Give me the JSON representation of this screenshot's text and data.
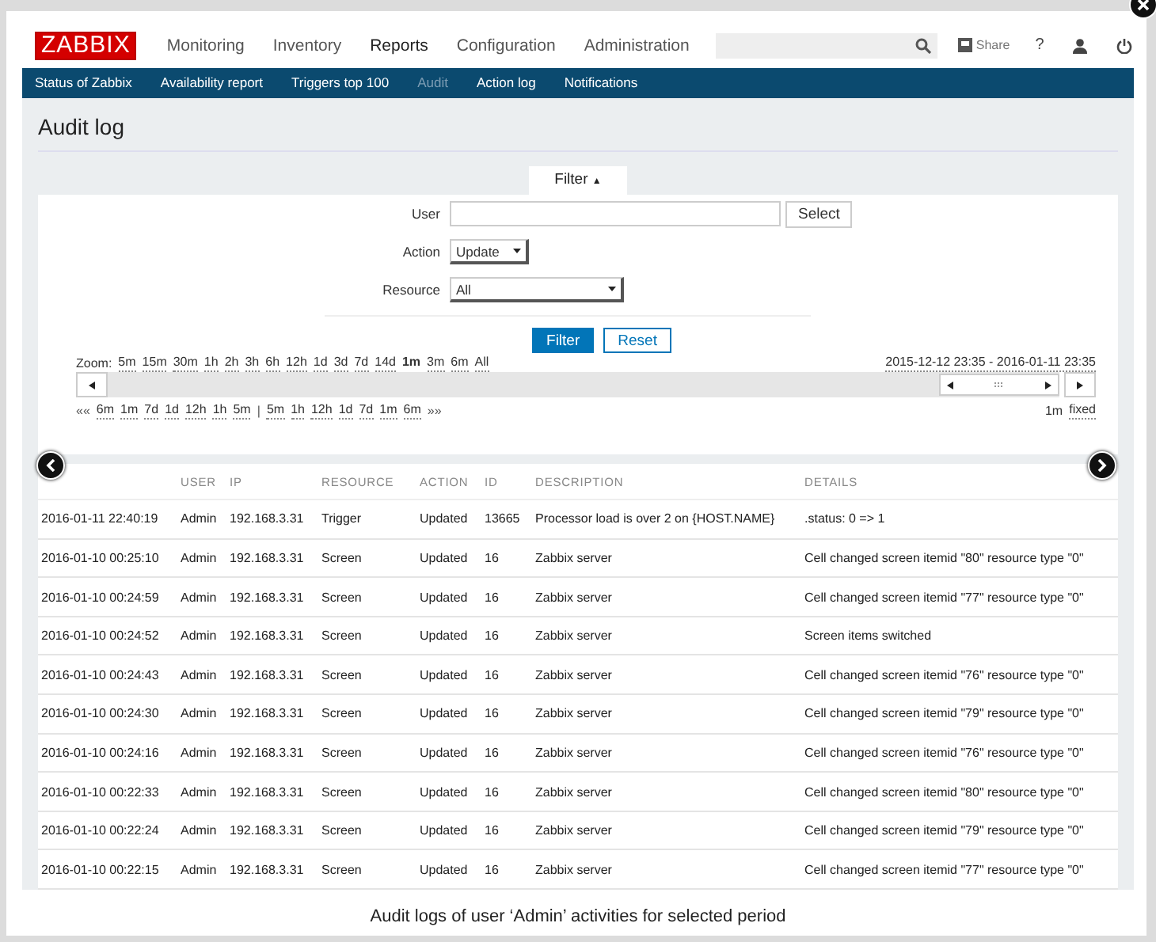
{
  "header": {
    "logo": "ZABBIX",
    "menu": [
      {
        "label": "Monitoring",
        "selected": false
      },
      {
        "label": "Inventory",
        "selected": false
      },
      {
        "label": "Reports",
        "selected": true
      },
      {
        "label": "Configuration",
        "selected": false
      },
      {
        "label": "Administration",
        "selected": false
      }
    ],
    "share": "Share",
    "help": "?"
  },
  "submenu": [
    {
      "label": "Status of Zabbix",
      "selected": false
    },
    {
      "label": "Availability report",
      "selected": false
    },
    {
      "label": "Triggers top 100",
      "selected": false
    },
    {
      "label": "Audit",
      "selected": true
    },
    {
      "label": "Action log",
      "selected": false
    },
    {
      "label": "Notifications",
      "selected": false
    }
  ],
  "page_title": "Audit log",
  "filter": {
    "tab": "Filter",
    "tab_arrow": "▲",
    "user_label": "User",
    "select_button": "Select",
    "action_label": "Action",
    "action_value": "Update",
    "resource_label": "Resource",
    "resource_value": "All",
    "apply_button": "Filter",
    "reset_button": "Reset"
  },
  "timeline": {
    "zoom_label": "Zoom:",
    "zoom": [
      {
        "label": "5m",
        "selected": false
      },
      {
        "label": "15m",
        "selected": false
      },
      {
        "label": "30m",
        "selected": false
      },
      {
        "label": "1h",
        "selected": false
      },
      {
        "label": "2h",
        "selected": false
      },
      {
        "label": "3h",
        "selected": false
      },
      {
        "label": "6h",
        "selected": false
      },
      {
        "label": "12h",
        "selected": false
      },
      {
        "label": "1d",
        "selected": false
      },
      {
        "label": "3d",
        "selected": false
      },
      {
        "label": "7d",
        "selected": false
      },
      {
        "label": "14d",
        "selected": false
      },
      {
        "label": "1m",
        "selected": true
      },
      {
        "label": "3m",
        "selected": false
      },
      {
        "label": "6m",
        "selected": false
      },
      {
        "label": "All",
        "selected": false
      }
    ],
    "period": "2015-12-12 23:35 - 2016-01-11 23:35",
    "nav": [
      {
        "label": "««",
        "kind": "sep"
      },
      {
        "label": "6m",
        "kind": "link"
      },
      {
        "label": "1m",
        "kind": "link"
      },
      {
        "label": "7d",
        "kind": "link"
      },
      {
        "label": "1d",
        "kind": "link"
      },
      {
        "label": "12h",
        "kind": "link"
      },
      {
        "label": "1h",
        "kind": "link"
      },
      {
        "label": "5m",
        "kind": "link"
      },
      {
        "label": "|",
        "kind": "sep"
      },
      {
        "label": "5m",
        "kind": "link"
      },
      {
        "label": "1h",
        "kind": "link"
      },
      {
        "label": "12h",
        "kind": "link"
      },
      {
        "label": "1d",
        "kind": "link"
      },
      {
        "label": "7d",
        "kind": "link"
      },
      {
        "label": "1m",
        "kind": "link"
      },
      {
        "label": "6m",
        "kind": "link"
      },
      {
        "label": "»»",
        "kind": "sep"
      }
    ],
    "period_length": "1m",
    "fixed": "fixed"
  },
  "table": {
    "columns": [
      "",
      "USER",
      "IP",
      "RESOURCE",
      "ACTION",
      "ID",
      "DESCRIPTION",
      "DETAILS"
    ],
    "rows": [
      [
        "2016-01-11 22:40:19",
        "Admin",
        "192.168.3.31",
        "Trigger",
        "Updated",
        "13665",
        "Processor load is over 2 on {HOST.NAME}",
        ".status: 0 => 1"
      ],
      [
        "2016-01-10 00:25:10",
        "Admin",
        "192.168.3.31",
        "Screen",
        "Updated",
        "16",
        "Zabbix server",
        "Cell changed screen itemid \"80\" resource type \"0\""
      ],
      [
        "2016-01-10 00:24:59",
        "Admin",
        "192.168.3.31",
        "Screen",
        "Updated",
        "16",
        "Zabbix server",
        "Cell changed screen itemid \"77\" resource type \"0\""
      ],
      [
        "2016-01-10 00:24:52",
        "Admin",
        "192.168.3.31",
        "Screen",
        "Updated",
        "16",
        "Zabbix server",
        "Screen items switched"
      ],
      [
        "2016-01-10 00:24:43",
        "Admin",
        "192.168.3.31",
        "Screen",
        "Updated",
        "16",
        "Zabbix server",
        "Cell changed screen itemid \"76\" resource type \"0\""
      ],
      [
        "2016-01-10 00:24:30",
        "Admin",
        "192.168.3.31",
        "Screen",
        "Updated",
        "16",
        "Zabbix server",
        "Cell changed screen itemid \"79\" resource type \"0\""
      ],
      [
        "2016-01-10 00:24:16",
        "Admin",
        "192.168.3.31",
        "Screen",
        "Updated",
        "16",
        "Zabbix server",
        "Cell changed screen itemid \"76\" resource type \"0\""
      ],
      [
        "2016-01-10 00:22:33",
        "Admin",
        "192.168.3.31",
        "Screen",
        "Updated",
        "16",
        "Zabbix server",
        "Cell changed screen itemid \"80\" resource type \"0\""
      ],
      [
        "2016-01-10 00:22:24",
        "Admin",
        "192.168.3.31",
        "Screen",
        "Updated",
        "16",
        "Zabbix server",
        "Cell changed screen itemid \"79\" resource type \"0\""
      ],
      [
        "2016-01-10 00:22:15",
        "Admin",
        "192.168.3.31",
        "Screen",
        "Updated",
        "16",
        "Zabbix server",
        "Cell changed screen itemid \"77\" resource type \"0\""
      ]
    ]
  },
  "caption": "Audit logs of user ‘Admin’ activities for selected period"
}
